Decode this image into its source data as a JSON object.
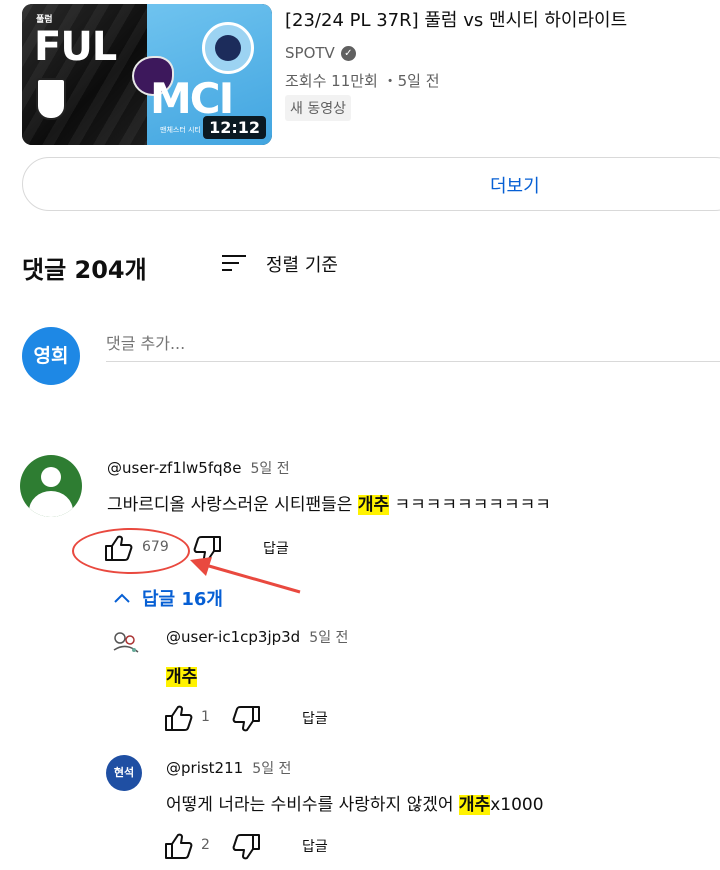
{
  "video": {
    "title": "[23/24 PL 37R] 풀럼 vs 맨시티 하이라이트",
    "channel": "SPOTV",
    "meta": "조회수 11만회 ・5일 전",
    "badge": "새 동영상",
    "duration": "12:12",
    "thumb_small": "풀럼",
    "thumb_left_text": "FUL",
    "thumb_right_text": "MCI",
    "thumb_sub": "맨체스터 시티"
  },
  "more_button": {
    "label": "더보기"
  },
  "comments_header": {
    "count_label": "댓글 204개",
    "sort_label": "정렬 기준"
  },
  "add_comment": {
    "avatar_text": "영희",
    "placeholder": "댓글 추가..."
  },
  "comments": [
    {
      "author": "@user-zf1lw5fq8e",
      "time": "5일 전",
      "text_before": "그바르디올 사랑스러운 시티팬들은 ",
      "highlight": "개추",
      "text_after": " ㅋㅋㅋㅋㅋㅋㅋㅋㅋㅋ",
      "likes": "679",
      "reply_label": "답글"
    }
  ],
  "replies_toggle": {
    "label": "답글 16개"
  },
  "replies": [
    {
      "author": "@user-ic1cp3jp3d",
      "time": "5일 전",
      "text_before": "",
      "highlight": "개추",
      "text_after": "",
      "likes": "1",
      "reply_label": "답글"
    },
    {
      "author": "@prist211",
      "time": "5일 전",
      "avatar_text": "현석",
      "text_before": "어떻게 너라는 수비수를 사랑하지 않겠어 ",
      "highlight": "개추",
      "text_after": "x1000",
      "likes": "2",
      "reply_label": "답글"
    }
  ],
  "colors": {
    "link": "#065fd4",
    "highlight": "#fff200",
    "annotation": "#e9493f",
    "avatar": "#1e88e5"
  }
}
